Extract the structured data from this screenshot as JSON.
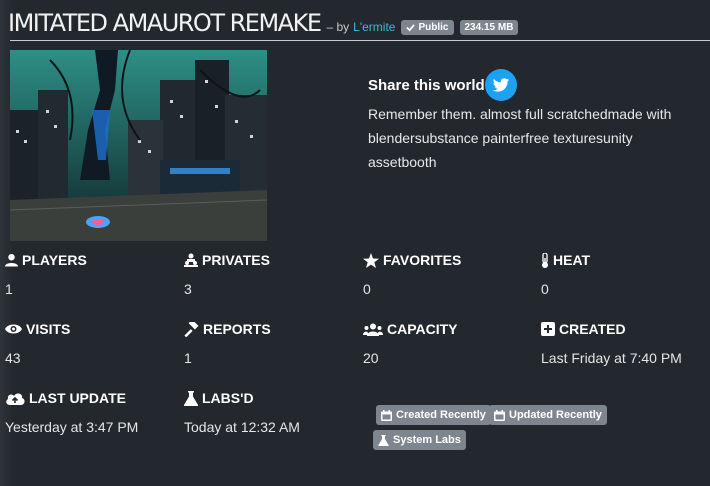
{
  "world": {
    "title": "IMITATED AMAUROT REMAKE",
    "by_prefix": "– by",
    "author": "L'ermite",
    "visibility": "Public",
    "size": "234.15 MB"
  },
  "share": {
    "heading": "Share this world",
    "description": "Remember them. almost full scratchedmade with blendersubstance painterfree texturesunity assetbooth"
  },
  "stats": {
    "players": {
      "label": "PLAYERS",
      "value": "1",
      "icon": "user-icon"
    },
    "privates": {
      "label": "PRIVATES",
      "value": "3",
      "icon": "users-private-icon"
    },
    "favorites": {
      "label": "FAVORITES",
      "value": "0",
      "icon": "star-icon"
    },
    "heat": {
      "label": "HEAT",
      "value": "0",
      "icon": "thermometer-icon"
    },
    "visits": {
      "label": "VISITS",
      "value": "43",
      "icon": "eye-icon"
    },
    "reports": {
      "label": "REPORTS",
      "value": "1",
      "icon": "hammer-icon"
    },
    "capacity": {
      "label": "CAPACITY",
      "value": "20",
      "icon": "users-icon"
    },
    "created": {
      "label": "CREATED",
      "value": "Last Friday at 7:40 PM",
      "icon": "plus-square-icon"
    },
    "last_update": {
      "label": "LAST UPDATE",
      "value": "Yesterday at 3:47 PM",
      "icon": "cloud-upload-icon"
    },
    "labsd": {
      "label": "LABS'D",
      "value": "Today at 12:32 AM",
      "icon": "flask-icon"
    }
  },
  "tags": [
    {
      "label": "Created Recently",
      "icon": "calendar-icon"
    },
    {
      "label": "Updated Recently",
      "icon": "calendar-icon"
    },
    {
      "label": "System Labs",
      "icon": "flask-icon"
    }
  ],
  "colors": {
    "background": "#23272e",
    "accent_link": "#3fb8d8",
    "badge": "#7d858f",
    "twitter": "#1da1f2"
  }
}
